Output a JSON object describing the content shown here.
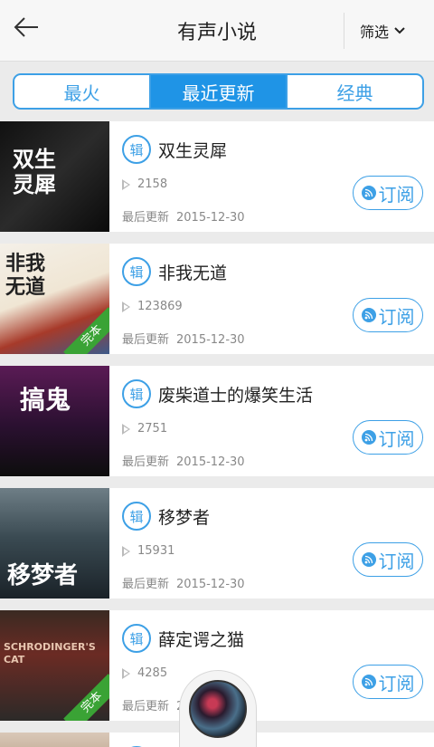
{
  "header": {
    "title": "有声小说",
    "filter_label": "筛选"
  },
  "tabs": [
    {
      "label": "最火",
      "active": false
    },
    {
      "label": "最近更新",
      "active": true
    },
    {
      "label": "经典",
      "active": false
    }
  ],
  "album_badge": "辑",
  "subscribe_label": "订阅",
  "updated_prefix": "最后更新",
  "items": [
    {
      "title": "双生灵犀",
      "plays": "2158",
      "date": "2015-12-30",
      "cover_text": "双生灵犀",
      "completed": false
    },
    {
      "title": "非我无道",
      "plays": "123869",
      "date": "2015-12-30",
      "cover_text": "非我无道",
      "completed": true
    },
    {
      "title": "废柴道士的爆笑生活",
      "plays": "2751",
      "date": "2015-12-30",
      "cover_text": "搞鬼",
      "completed": false
    },
    {
      "title": "移梦者",
      "plays": "15931",
      "date": "2015-12-30",
      "cover_text": "移梦者",
      "completed": false
    },
    {
      "title": "薛定谔之猫",
      "plays": "4285",
      "date": "2015-12-30",
      "cover_text": "SCHRODINGER'S CAT",
      "completed": true
    }
  ],
  "completed_badge": "完本",
  "colors": {
    "accent": "#3da0e6",
    "tab_active_bg": "#1f94e6",
    "completed": "#3aa335"
  }
}
